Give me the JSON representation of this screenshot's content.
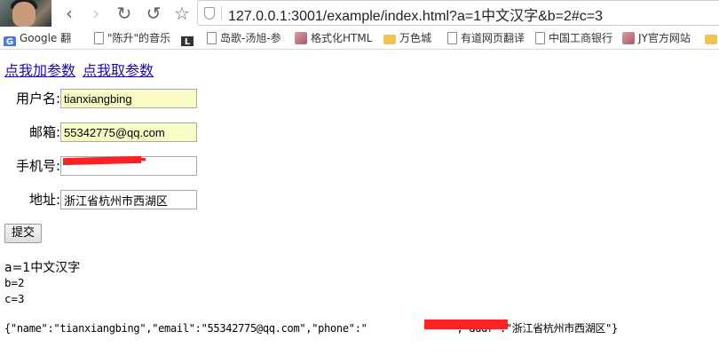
{
  "browser": {
    "url": "127.0.0.1:3001/example/index.html?a=1中文汉字&b=2#c=3",
    "nav": {
      "back": "‹",
      "forward": "›",
      "reload": "↻",
      "undo": "↺",
      "bookmark": "☆"
    },
    "bookmarks": [
      {
        "label": "Google 翻",
        "icon": "google-icon"
      },
      {
        "label": "\"陈升\"的音乐",
        "icon": "page-icon"
      },
      {
        "label": "",
        "icon": "black-square-icon"
      },
      {
        "label": "岛歌-汤旭-参",
        "icon": "page-icon"
      },
      {
        "label": "格式化HTML",
        "icon": "picture-icon"
      },
      {
        "label": "万色城",
        "icon": "folder-icon"
      },
      {
        "label": "有道网页翻译",
        "icon": "page-icon"
      },
      {
        "label": "中国工商银行",
        "icon": "page-icon"
      },
      {
        "label": "JY官方网站",
        "icon": "picture-icon"
      }
    ]
  },
  "page": {
    "links": {
      "add": "点我加参数",
      "get": "点我取参数"
    },
    "form": {
      "username_label": "用户名:",
      "username_value": "tianxiangbing",
      "email_label": "邮箱:",
      "email_value": "55342775@qq.com",
      "phone_label": "手机号:",
      "address_label": "地址:",
      "address_value": "浙江省杭州市西湖区",
      "submit_label": "提交"
    },
    "output": {
      "line_a": "a=1中文汉字",
      "line_b": "b=2",
      "line_c": "c=3",
      "json_start": "{\"name\":\"tianxiangbing\",\"email\":\"55342775@qq.com\",\"phone\":\"",
      "json_end": "\",\"addr\":\"浙江省杭州市西湖区\"}"
    }
  }
}
